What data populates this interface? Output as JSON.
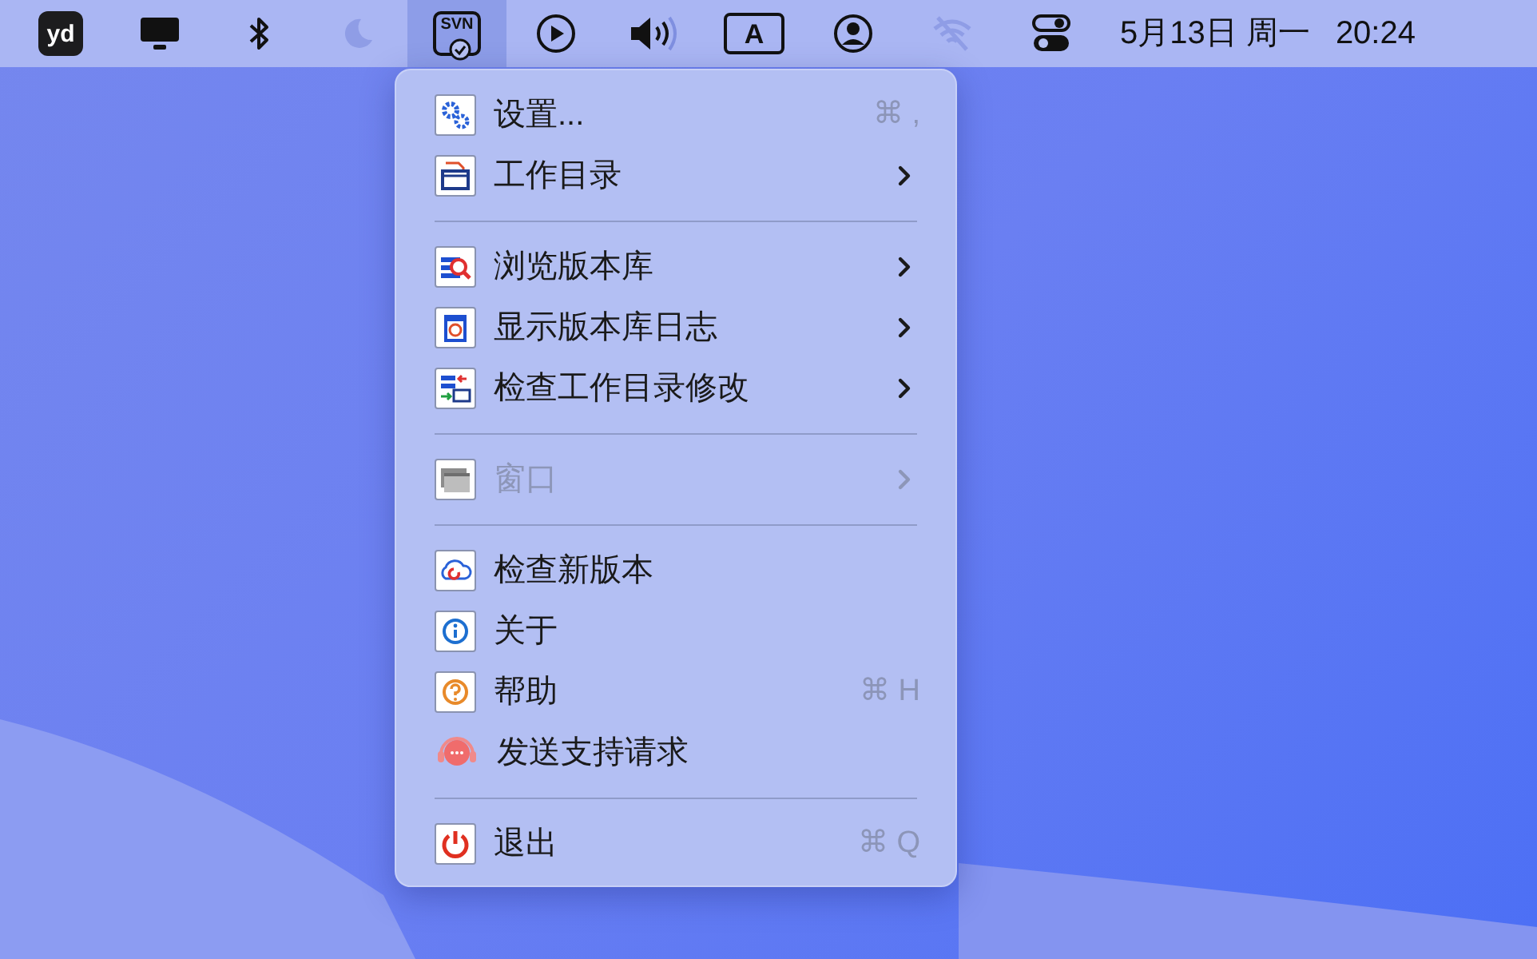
{
  "menu_bar": {
    "items": [
      {
        "kind": "logo",
        "label": "yd",
        "selected": false,
        "disabled": false
      },
      {
        "kind": "display",
        "selected": false,
        "disabled": false
      },
      {
        "kind": "bluetooth",
        "selected": false,
        "disabled": false
      },
      {
        "kind": "moon",
        "selected": false,
        "disabled": true
      },
      {
        "kind": "svn",
        "label": "SVN",
        "selected": true,
        "disabled": false
      },
      {
        "kind": "play",
        "selected": false,
        "disabled": false
      },
      {
        "kind": "volume",
        "selected": false,
        "disabled": false
      },
      {
        "kind": "input",
        "label": "A",
        "selected": false,
        "disabled": false
      },
      {
        "kind": "user",
        "selected": false,
        "disabled": false
      },
      {
        "kind": "wifi",
        "selected": false,
        "disabled": true
      },
      {
        "kind": "controls",
        "selected": false,
        "disabled": false
      }
    ],
    "date": "5月13日 周一",
    "time": "20:24"
  },
  "menu": {
    "sections": [
      {
        "items": [
          {
            "label": "设置...",
            "shortcut": "⌘ ,",
            "submenu": false,
            "disabled": false
          },
          {
            "label": "工作目录",
            "submenu": true,
            "disabled": false
          }
        ]
      },
      {
        "items": [
          {
            "label": "浏览版本库",
            "submenu": true,
            "disabled": false
          },
          {
            "label": "显示版本库日志",
            "submenu": true,
            "disabled": false
          },
          {
            "label": "检查工作目录修改",
            "submenu": true,
            "disabled": false
          }
        ]
      },
      {
        "items": [
          {
            "label": "窗口",
            "submenu": true,
            "disabled": true
          }
        ]
      },
      {
        "items": [
          {
            "label": "检查新版本",
            "submenu": false,
            "disabled": false
          },
          {
            "label": "关于",
            "submenu": false,
            "disabled": false
          },
          {
            "label": "帮助",
            "shortcut": "⌘ H",
            "submenu": false,
            "disabled": false
          },
          {
            "label": "发送支持请求",
            "submenu": false,
            "disabled": false
          }
        ]
      },
      {
        "items": [
          {
            "label": "退出",
            "shortcut": "⌘ Q",
            "submenu": false,
            "disabled": false
          }
        ]
      }
    ]
  }
}
